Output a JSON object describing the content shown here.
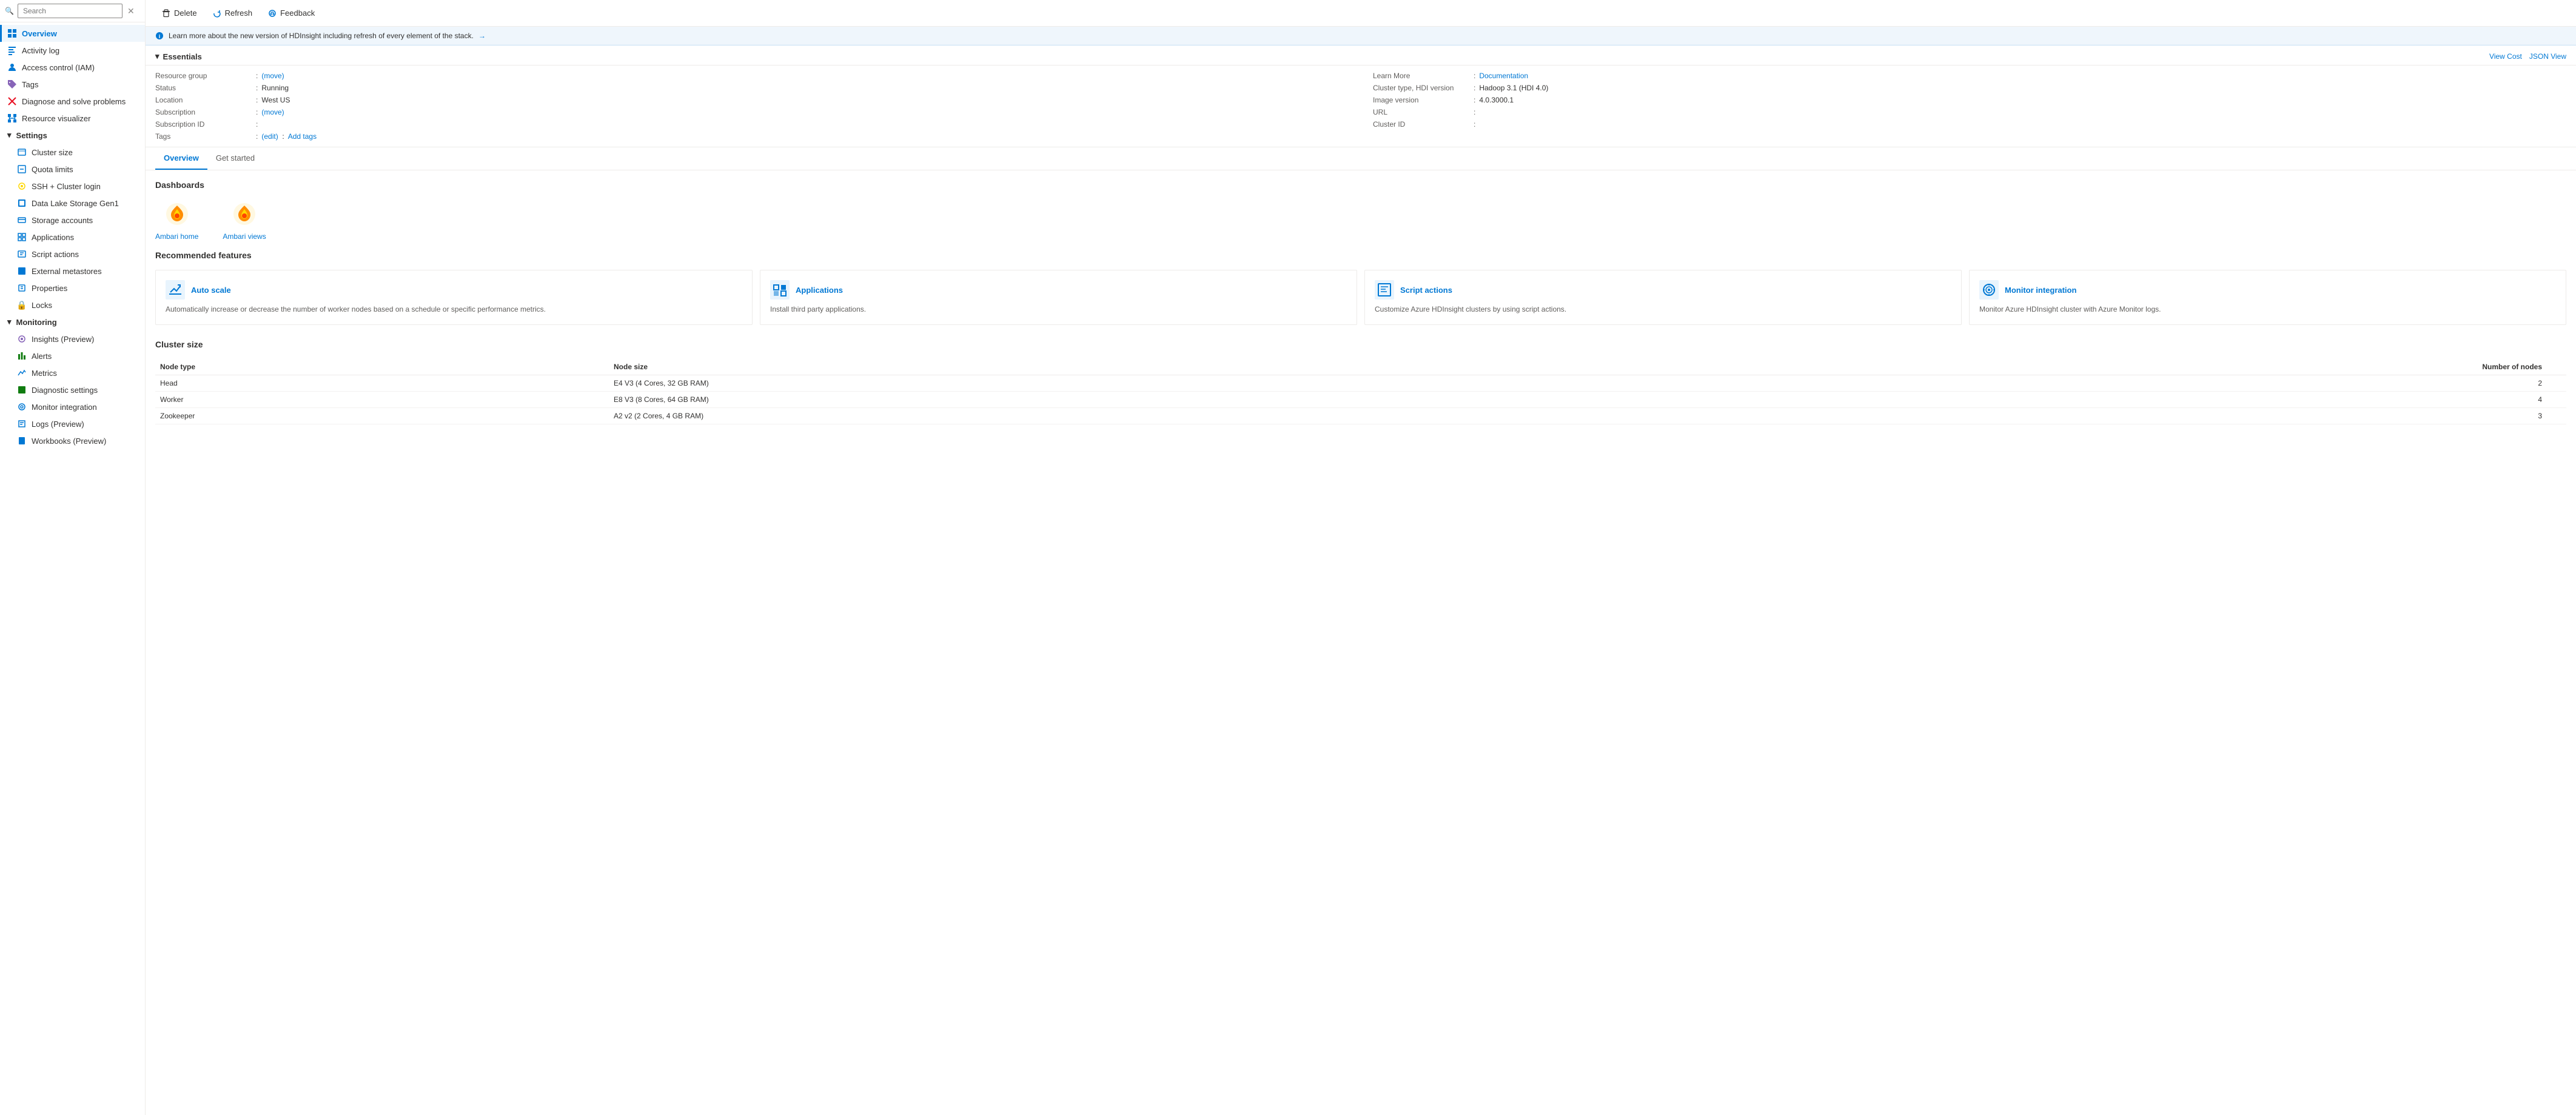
{
  "sidebar": {
    "search_placeholder": "Search",
    "items": [
      {
        "id": "overview",
        "label": "Overview",
        "icon": "⬡",
        "active": true,
        "indent": 0
      },
      {
        "id": "activity-log",
        "label": "Activity log",
        "icon": "📋",
        "active": false,
        "indent": 0
      },
      {
        "id": "access-control",
        "label": "Access control (IAM)",
        "icon": "👤",
        "active": false,
        "indent": 0
      },
      {
        "id": "tags",
        "label": "Tags",
        "icon": "🏷",
        "active": false,
        "indent": 0
      },
      {
        "id": "diagnose",
        "label": "Diagnose and solve problems",
        "icon": "✕",
        "active": false,
        "indent": 0
      },
      {
        "id": "resource-visualizer",
        "label": "Resource visualizer",
        "icon": "⊞",
        "active": false,
        "indent": 0
      },
      {
        "id": "settings",
        "label": "Settings",
        "section": true
      },
      {
        "id": "cluster-size",
        "label": "Cluster size",
        "icon": "✎",
        "active": false,
        "indent": 1
      },
      {
        "id": "quota-limits",
        "label": "Quota limits",
        "icon": "⊟",
        "active": false,
        "indent": 1
      },
      {
        "id": "ssh-cluster",
        "label": "SSH + Cluster login",
        "icon": "💡",
        "active": false,
        "indent": 1
      },
      {
        "id": "data-lake",
        "label": "Data Lake Storage Gen1",
        "icon": "⊞",
        "active": false,
        "indent": 1
      },
      {
        "id": "storage-accounts",
        "label": "Storage accounts",
        "icon": "⊟",
        "active": false,
        "indent": 1
      },
      {
        "id": "applications",
        "label": "Applications",
        "icon": "⊟",
        "active": false,
        "indent": 1
      },
      {
        "id": "script-actions",
        "label": "Script actions",
        "icon": "⊟",
        "active": false,
        "indent": 1
      },
      {
        "id": "external-metastores",
        "label": "External metastores",
        "icon": "⊟",
        "active": false,
        "indent": 1
      },
      {
        "id": "properties",
        "label": "Properties",
        "icon": "⊟",
        "active": false,
        "indent": 1
      },
      {
        "id": "locks",
        "label": "Locks",
        "icon": "🔒",
        "active": false,
        "indent": 1
      },
      {
        "id": "monitoring",
        "label": "Monitoring",
        "section": true
      },
      {
        "id": "insights",
        "label": "Insights (Preview)",
        "icon": "💡",
        "active": false,
        "indent": 1
      },
      {
        "id": "alerts",
        "label": "Alerts",
        "icon": "📊",
        "active": false,
        "indent": 1
      },
      {
        "id": "metrics",
        "label": "Metrics",
        "icon": "📈",
        "active": false,
        "indent": 1
      },
      {
        "id": "diagnostic-settings",
        "label": "Diagnostic settings",
        "icon": "⊟",
        "active": false,
        "indent": 1
      },
      {
        "id": "monitor-integration",
        "label": "Monitor integration",
        "icon": "⊙",
        "active": false,
        "indent": 1
      },
      {
        "id": "logs-preview",
        "label": "Logs (Preview)",
        "icon": "⊟",
        "active": false,
        "indent": 1
      },
      {
        "id": "workbooks-preview",
        "label": "Workbooks (Preview)",
        "icon": "⊟",
        "active": false,
        "indent": 1
      }
    ]
  },
  "toolbar": {
    "delete_label": "Delete",
    "refresh_label": "Refresh",
    "feedback_label": "Feedback"
  },
  "info_bar": {
    "text": "Learn more about the new version of HDInsight including refresh of every element of the stack.",
    "link_text": "→"
  },
  "essentials": {
    "title": "Essentials",
    "view_cost_label": "View Cost",
    "json_view_label": "JSON View",
    "left": [
      {
        "label": "Resource group",
        "value": "(move)",
        "is_link": true,
        "sep": ":"
      },
      {
        "label": "Status",
        "value": "Running",
        "sep": ":"
      },
      {
        "label": "Location",
        "value": "West US",
        "sep": ":"
      },
      {
        "label": "Subscription",
        "value": "(move)",
        "is_link": true,
        "sep": ":"
      },
      {
        "label": "Subscription ID",
        "value": "",
        "sep": ":"
      },
      {
        "label": "Tags",
        "value": "(edit)",
        "extra_link": "Add tags",
        "sep": ":"
      }
    ],
    "right": [
      {
        "label": "Learn More",
        "value": "Documentation",
        "is_link": true,
        "sep": ":"
      },
      {
        "label": "Cluster type, HDI version",
        "value": "Hadoop 3.1 (HDI 4.0)",
        "sep": ":"
      },
      {
        "label": "Image version",
        "value": "4.0.3000.1",
        "sep": ":"
      },
      {
        "label": "URL",
        "value": "",
        "sep": ":"
      },
      {
        "label": "Cluster ID",
        "value": "",
        "sep": ":"
      }
    ]
  },
  "tabs": [
    {
      "id": "overview",
      "label": "Overview",
      "active": true
    },
    {
      "id": "get-started",
      "label": "Get started",
      "active": false
    }
  ],
  "dashboards": {
    "title": "Dashboards",
    "items": [
      {
        "id": "ambari-home",
        "label": "Ambari home"
      },
      {
        "id": "ambari-views",
        "label": "Ambari views"
      }
    ]
  },
  "recommended": {
    "title": "Recommended features",
    "features": [
      {
        "id": "auto-scale",
        "title": "Auto scale",
        "description": "Automatically increase or decrease the number of worker nodes based on a schedule or specific performance metrics."
      },
      {
        "id": "applications",
        "title": "Applications",
        "description": "Install third party applications."
      },
      {
        "id": "script-actions",
        "title": "Script actions",
        "description": "Customize Azure HDInsight clusters by using script actions."
      },
      {
        "id": "monitor-integration",
        "title": "Monitor integration",
        "description": "Monitor Azure HDInsight cluster with Azure Monitor logs."
      }
    ]
  },
  "cluster_size": {
    "title": "Cluster size",
    "columns": [
      "Node type",
      "Node size",
      "Number of nodes"
    ],
    "rows": [
      {
        "type": "Head",
        "size": "E4 V3 (4 Cores, 32 GB RAM)",
        "nodes": "2"
      },
      {
        "type": "Worker",
        "size": "E8 V3 (8 Cores, 64 GB RAM)",
        "nodes": "4"
      },
      {
        "type": "Zookeeper",
        "size": "A2 v2 (2 Cores, 4 GB RAM)",
        "nodes": "3"
      }
    ]
  }
}
